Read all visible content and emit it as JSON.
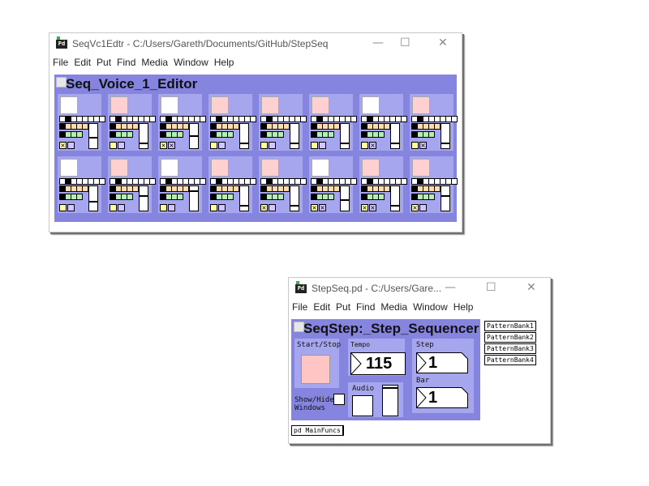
{
  "editor_window": {
    "icon_label": "Pd",
    "title": "SeqVc1Edtr  - C:/Users/Gareth/Documents/GitHub/StepSeq",
    "controls": {
      "minimize": "—",
      "maximize": "☐",
      "close": "✕"
    },
    "menu": [
      "File",
      "Edit",
      "Put",
      "Find",
      "Media",
      "Window",
      "Help"
    ],
    "gop_title": "Seq_Voice_1_Editor"
  },
  "main_window": {
    "icon_label": "Pd",
    "title": "StepSeq.pd  - C:/Users/Gare...",
    "controls": {
      "minimize": "—",
      "maximize": "☐",
      "close": "✕"
    },
    "menu": [
      "File",
      "Edit",
      "Put",
      "Find",
      "Media",
      "Window",
      "Help"
    ],
    "gop_title": "SeqStep:_Step_Sequencer",
    "start_stop_label": "Start/Stop",
    "tempo_label": "Tempo",
    "tempo_value": "115",
    "step_label": "Step",
    "step_value": "1",
    "bar_label": "Bar",
    "bar_value": "1",
    "audio_label": "Audio",
    "show_hide_label_1": "Show/Hide",
    "show_hide_label_2": "Windows",
    "pattern_banks": [
      "PatternBank1",
      "PatternBank2",
      "PatternBank3",
      "PatternBank4"
    ],
    "subpatch_label": "pd MainFuncs"
  },
  "colors": {
    "gop_background": "#8585e0",
    "cell_background": "#a6a6ef",
    "bang_white": "#ffffff",
    "bang_pink": "#ffd0d0",
    "start_stop_fill": "#ffc4c4",
    "row2_cells": "#ffdcaa",
    "row3_cells": "#b2f0b2",
    "toggle_yellow": "#ffffa0",
    "toggle_lilac": "#d4c4ff"
  },
  "editor_cells": [
    {
      "bang": "white",
      "toggles": [
        "x",
        ""
      ],
      "slider_level": 0.45
    },
    {
      "bang": "pink",
      "toggles": [
        "",
        ""
      ],
      "slider_level": 0.2
    },
    {
      "bang": "white",
      "toggles": [
        "x",
        "x"
      ],
      "slider_level": 0.55
    },
    {
      "bang": "pink",
      "toggles": [
        "",
        ""
      ],
      "slider_level": 0.2
    },
    {
      "bang": "pink",
      "toggles": [
        "",
        ""
      ],
      "slider_level": 0.2
    },
    {
      "bang": "pink",
      "toggles": [
        "",
        ""
      ],
      "slider_level": 0.2
    },
    {
      "bang": "white",
      "toggles": [
        "",
        "x"
      ],
      "slider_level": 0.2
    },
    {
      "bang": "pink",
      "toggles": [
        "",
        "x"
      ],
      "slider_level": 0.2
    },
    {
      "bang": "white",
      "toggles": [
        "",
        ""
      ],
      "slider_level": 0.4
    },
    {
      "bang": "pink",
      "toggles": [
        "",
        ""
      ],
      "slider_level": 0.65
    },
    {
      "bang": "white",
      "toggles": [
        "",
        ""
      ],
      "slider_level": 0.9
    },
    {
      "bang": "pink",
      "toggles": [
        "",
        ""
      ],
      "slider_level": 0.2
    },
    {
      "bang": "pink",
      "toggles": [
        "x",
        ""
      ],
      "slider_level": 0.2
    },
    {
      "bang": "white",
      "toggles": [
        "x",
        "x"
      ],
      "slider_level": 0.45
    },
    {
      "bang": "pink",
      "toggles": [
        "x",
        "x"
      ],
      "slider_level": 0.2
    },
    {
      "bang": "pink",
      "toggles": [
        "x",
        ""
      ],
      "slider_level": 0.65
    }
  ]
}
